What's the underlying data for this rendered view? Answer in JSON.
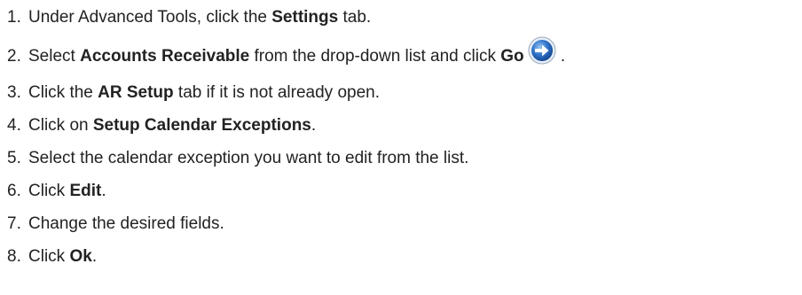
{
  "steps": [
    {
      "num": "1.",
      "parts": [
        "Under Advanced Tools, click the ",
        "Settings",
        " tab."
      ]
    },
    {
      "num": "2.",
      "parts": [
        "Select ",
        "Accounts Receivable",
        " from the drop-down list and click ",
        "Go",
        " ."
      ],
      "icon": "go-arrow-icon"
    },
    {
      "num": "3.",
      "parts": [
        "Click the ",
        "AR Setup",
        " tab if it is not already open."
      ]
    },
    {
      "num": "4.",
      "parts": [
        "Click on ",
        "Setup Calendar Exceptions",
        "."
      ]
    },
    {
      "num": "5.",
      "text": "Select the calendar exception you want to edit from the list."
    },
    {
      "num": "6.",
      "parts": [
        "Click ",
        "Edit",
        "."
      ]
    },
    {
      "num": "7.",
      "text": "Change the desired fields."
    },
    {
      "num": "8.",
      "parts": [
        "Click ",
        "Ok",
        "."
      ]
    }
  ],
  "colors": {
    "text": "#222222",
    "icon_blue": "#2f74c9"
  }
}
